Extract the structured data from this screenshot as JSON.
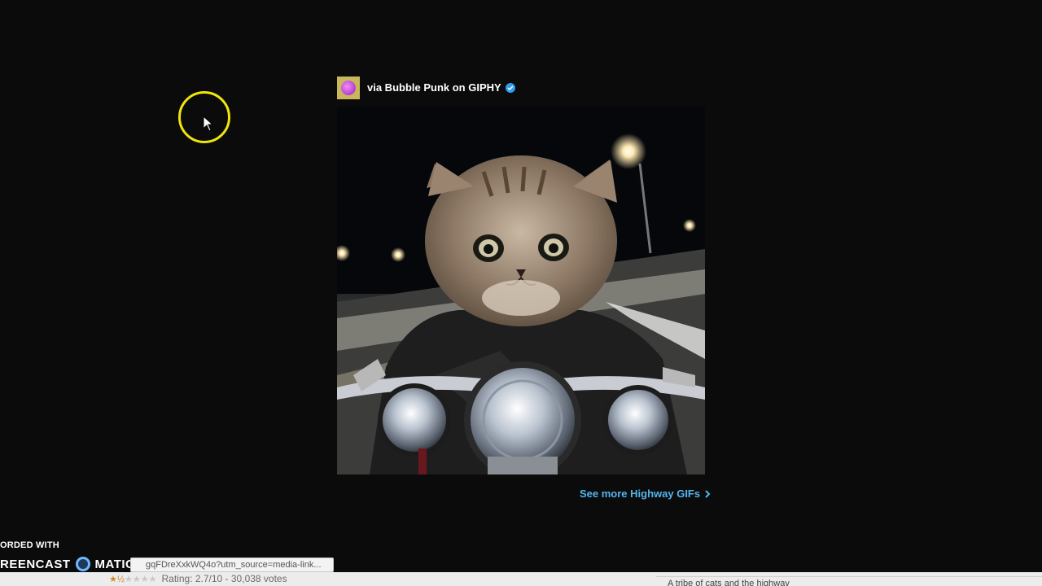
{
  "embed": {
    "via_text": "via Bubble Punk on GIPHY",
    "see_more": "See more Highway GIFs"
  },
  "recorder": {
    "label": "ORDED WITH",
    "brand_left": "REENCAST",
    "brand_right": "MATIC"
  },
  "status_bar": {
    "url": "gqFDreXxkWQ4o?utm_source=media-link...",
    "rating_text": "Rating: 2.7/10 - 30,038 votes",
    "stars_filled": 1.5,
    "stars_total": 5,
    "bottom_right": "A tribe of cats and the highway"
  },
  "colors": {
    "cursor_ring": "#f0e60a",
    "link": "#53b4ee",
    "verified": "#2f9ef0",
    "star_on": "#d08a2a"
  },
  "icons": {
    "cursor": "mouse-pointer-icon",
    "verified": "verified-check-icon",
    "chevron": "chevron-right-icon"
  }
}
